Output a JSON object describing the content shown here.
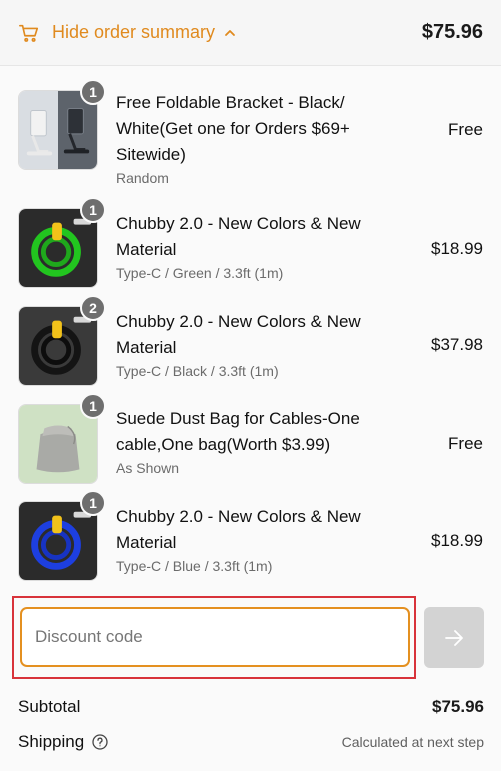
{
  "header": {
    "toggle_label": "Hide order summary",
    "cart_icon": "cart-icon",
    "chevron_icon": "chevron-up-icon",
    "total": "$75.96",
    "accent_color": "#e08a1e"
  },
  "items": [
    {
      "qty": "1",
      "title": "Free Foldable Bracket - Black/ White(Get one for Orders $69+ Sitewide)",
      "variant": "Random",
      "price": "Free"
    },
    {
      "qty": "1",
      "title": "Chubby 2.0 - New Colors & New Material",
      "variant": "Type-C / Green / 3.3ft (1m)",
      "price": "$18.99"
    },
    {
      "qty": "2",
      "title": "Chubby 2.0 - New Colors & New Material",
      "variant": "Type-C / Black / 3.3ft (1m)",
      "price": "$37.98"
    },
    {
      "qty": "1",
      "title": "Suede Dust Bag for Cables-One cable,One bag(Worth $3.99)",
      "variant": "As Shown",
      "price": "Free"
    },
    {
      "qty": "1",
      "title": "Chubby 2.0 - New Colors & New Material",
      "variant": "Type-C / Blue / 3.3ft (1m)",
      "price": "$18.99"
    }
  ],
  "discount": {
    "placeholder": "Discount code",
    "value": "",
    "apply_icon": "arrow-right-icon"
  },
  "summary": {
    "subtotal_label": "Subtotal",
    "subtotal_value": "$75.96",
    "shipping_label": "Shipping",
    "shipping_value": "Calculated at next step",
    "shipping_help_icon": "question-circle-icon"
  }
}
